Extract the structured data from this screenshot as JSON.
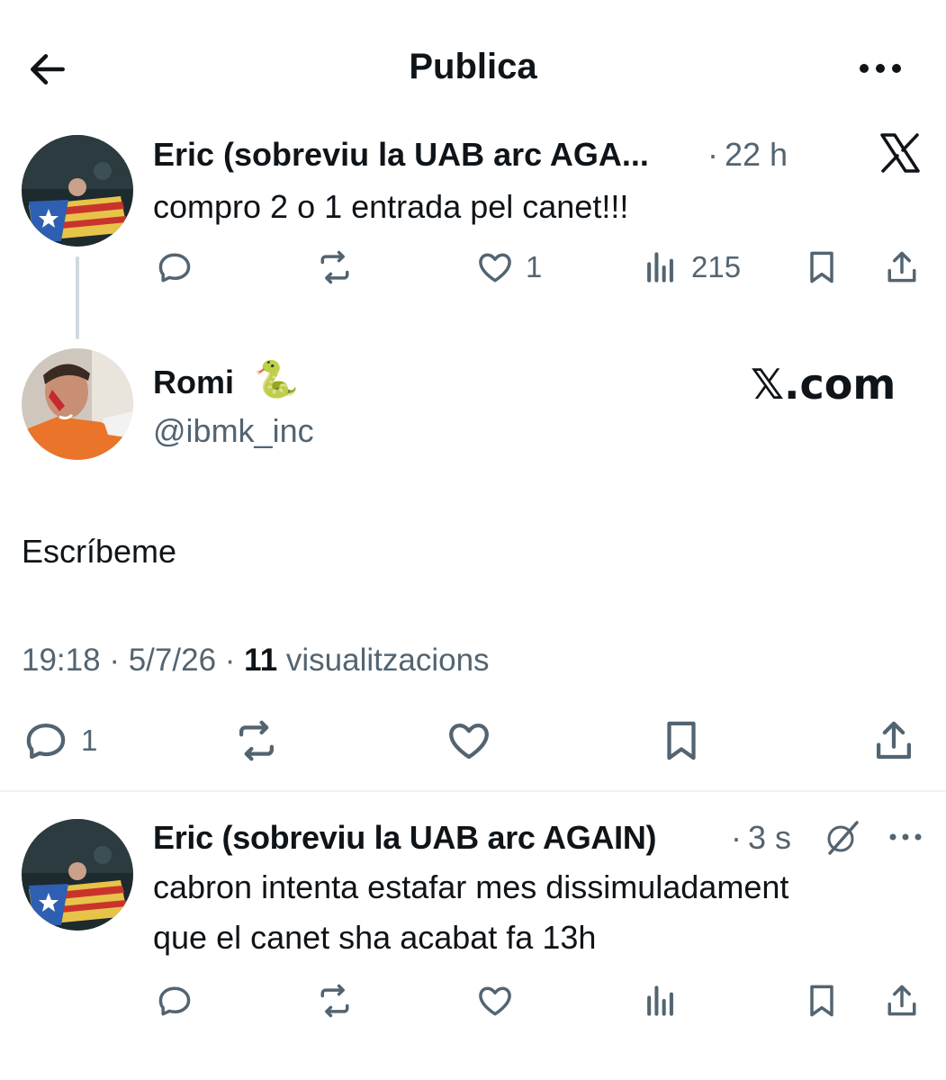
{
  "header": {
    "title": "Publica"
  },
  "parent_tweet": {
    "author_name": "Eric (sobreviu la UAB arc AGA...",
    "separator": "·",
    "time": "22 h",
    "text": "compro 2 o 1 entrada pel canet!!!",
    "likes": "1",
    "views": "215"
  },
  "main_tweet": {
    "author_name": "Romi",
    "author_emoji": "🐍",
    "handle": "@ibmk_inc",
    "watermark": "𝕏.com",
    "text": "Escríbeme",
    "time": "19:18",
    "date": "5/7/26",
    "dot": "·",
    "views_count": "11",
    "views_label": "visualitzacions",
    "replies": "1"
  },
  "reply_tweet": {
    "author_name": "Eric (sobreviu la UAB arc AGAIN)",
    "separator": "·",
    "time": "3 s",
    "text_line1": "cabron intenta estafar mes dissimuladament",
    "text_line2": "que el canet sha acabat fa 13h"
  },
  "colors": {
    "text": "#0f1419",
    "secondary": "#536471",
    "divider": "#eff3f4",
    "thread_line": "#cfd9de"
  }
}
